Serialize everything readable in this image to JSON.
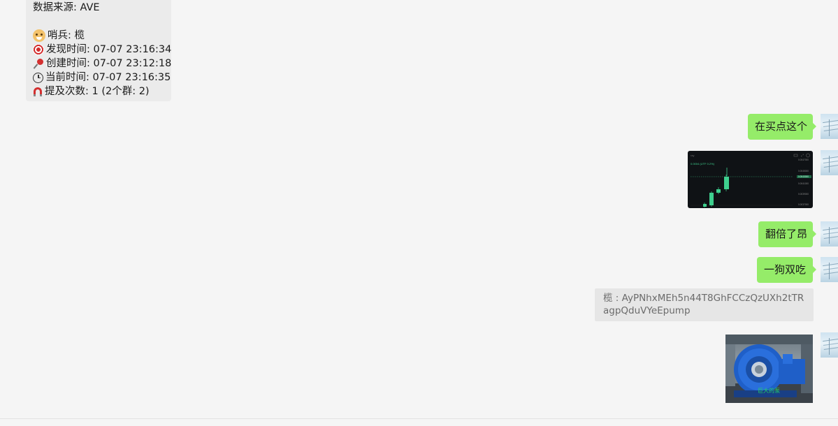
{
  "left_message": {
    "source_line": "数据来源: AVE",
    "sentinel_line": "哨兵: 榄",
    "found_time_line": "发现时间: 07-07 23:16:34",
    "created_time_line": "创建时间: 07-07 23:12:18",
    "current_time_line": "当前时间: 07-07 23:16:35",
    "mentions_line": "提及次数: 1 (2个群: 2)",
    "icons": [
      "dog-face-icon",
      "target-icon",
      "pushpin-icon",
      "clock-icon",
      "magnet-icon"
    ]
  },
  "messages": [
    {
      "type": "text",
      "text": "在买点这个"
    },
    {
      "type": "image",
      "description_icon": "candlestick-chart-image",
      "chart_header": "0.0004 (UTF 0.2%)",
      "price_labels": [
        "0.0047000",
        "0.0045000",
        "0.0043000",
        "0.0041000",
        "0.0039000",
        "0.0037000"
      ]
    },
    {
      "type": "text",
      "text": "翻倍了昂"
    },
    {
      "type": "text",
      "text": "一狗双吃"
    },
    {
      "type": "quote",
      "text": "榄 : AyPNhxMEh5n44T8GhFCCzQzUXh2tTRagpQduVYeEpump"
    },
    {
      "type": "image",
      "description_icon": "pump-photo-image",
      "caption": "巨大的泵"
    }
  ],
  "colors": {
    "background": "#f5f5f5",
    "own_bubble": "#95ec69",
    "other_bubble": "#ebebeb",
    "quote_bg": "#e6e6e6",
    "candle_up": "#3ecf8e",
    "pump_blue": "#1f5fc8"
  }
}
